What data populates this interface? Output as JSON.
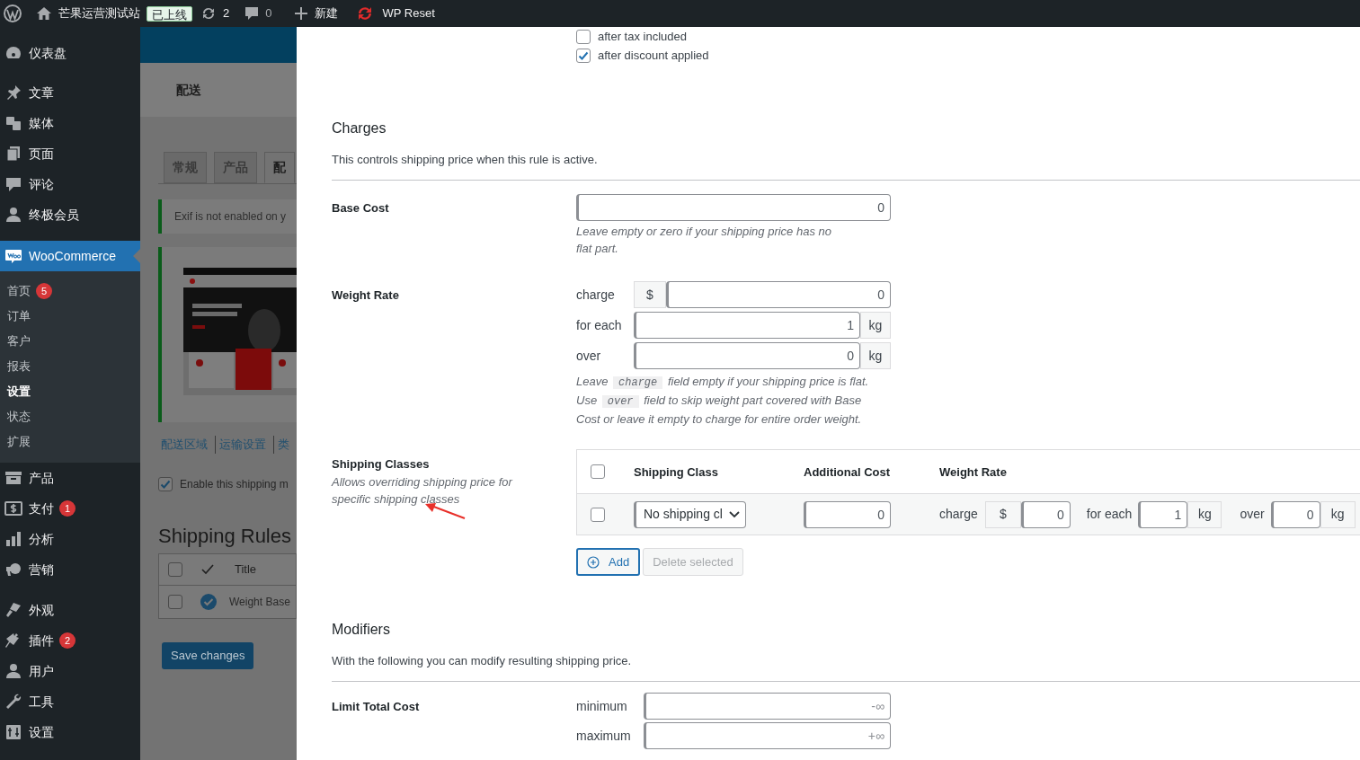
{
  "admin_bar": {
    "site_name": "芒果运营测试站",
    "status_badge": "已上线",
    "updates": "2",
    "comments": "0",
    "new": "新建",
    "plugin": "WP Reset"
  },
  "sidebar": {
    "items": [
      {
        "label": "仪表盘",
        "selected": false
      },
      {
        "label": "文章",
        "selected": false
      },
      {
        "label": "媒体",
        "selected": false
      },
      {
        "label": "页面",
        "selected": false
      },
      {
        "label": "评论",
        "selected": false
      },
      {
        "label": "终极会员",
        "selected": false
      },
      {
        "label": "WooCommerce",
        "selected": true,
        "children": [
          {
            "label": "首页",
            "badge": "5",
            "selected": false
          },
          {
            "label": "订单",
            "selected": false
          },
          {
            "label": "客户",
            "selected": false
          },
          {
            "label": "报表",
            "selected": false
          },
          {
            "label": "设置",
            "selected": true
          },
          {
            "label": "状态",
            "selected": false
          },
          {
            "label": "扩展",
            "selected": false
          }
        ]
      },
      {
        "label": "产品",
        "selected": false
      },
      {
        "label": "支付",
        "badge": "1",
        "selected": false
      },
      {
        "label": "分析",
        "selected": false
      },
      {
        "label": "营销",
        "selected": false
      },
      {
        "label": "外观",
        "selected": false
      },
      {
        "label": "插件",
        "badge": "2",
        "selected": false
      },
      {
        "label": "用户",
        "selected": false
      },
      {
        "label": "工具",
        "selected": false
      },
      {
        "label": "设置",
        "selected": false
      }
    ]
  },
  "background_page": {
    "title": "配送",
    "tabs": [
      {
        "label": "常规",
        "selected": false
      },
      {
        "label": "产品",
        "selected": false
      },
      {
        "label": "配",
        "selected": true
      }
    ],
    "notice": "Exif is not enabled on y",
    "links": [
      "配送区域",
      "运输设置",
      "类"
    ],
    "enable_option": {
      "label": "Enable this shipping m",
      "checked": true
    },
    "heading": "Shipping Rules",
    "rules_table": {
      "header_checked": false,
      "columns": [
        "Title"
      ],
      "rows": [
        {
          "selected": false,
          "enabled": true,
          "title": "Weight Base"
        }
      ]
    },
    "save_button": "Save changes"
  },
  "rule_editor": {
    "apply_options": [
      {
        "label": "after tax included",
        "checked": false
      },
      {
        "label": "after discount applied",
        "checked": true
      }
    ],
    "charges": {
      "title": "Charges",
      "description": "This controls shipping price when this rule is active.",
      "base_cost": {
        "label": "Base Cost",
        "value": "0",
        "help": "Leave empty or zero if your shipping price has no flat part."
      },
      "weight_rate": {
        "label": "Weight Rate",
        "fields": [
          {
            "label": "charge",
            "prefix": "$",
            "value": "0"
          },
          {
            "label": "for each",
            "value": "1",
            "suffix": "kg"
          },
          {
            "label": "over",
            "value": "0",
            "suffix": "kg"
          }
        ],
        "help": [
          {
            "kind": "text",
            "text": "Leave "
          },
          {
            "kind": "code",
            "text": "charge"
          },
          {
            "kind": "text",
            "text": " field empty if your shipping price is flat. Use "
          },
          {
            "kind": "code",
            "text": "over"
          },
          {
            "kind": "text",
            "text": " field to skip weight part covered with Base Cost or leave it empty to charge for entire order weight."
          }
        ]
      },
      "shipping_classes": {
        "label": "Shipping Classes",
        "description": "Allows overriding shipping price for specific shipping classes",
        "header_checked": false,
        "columns": [
          "Shipping Class",
          "Additional Cost",
          "Weight Rate"
        ],
        "rows": [
          {
            "selected": false,
            "shipping_class": "No shipping cl",
            "additional_cost": "0",
            "charge_label": "charge",
            "currency": "$",
            "charge": "0",
            "for_each_label": "for each",
            "for_each": "1",
            "for_each_unit": "kg",
            "over_label": "over",
            "over": "0",
            "over_unit": "kg"
          }
        ],
        "buttons": [
          {
            "kind": "add",
            "label": "Add",
            "disabled": false
          },
          {
            "kind": "delete",
            "label": "Delete selected",
            "disabled": true
          }
        ]
      }
    },
    "modifiers": {
      "title": "Modifiers",
      "description": "With the following you can modify resulting shipping price.",
      "limit_total_cost": {
        "label": "Limit Total Cost",
        "fields": [
          {
            "label": "minimum",
            "placeholder": "-∞"
          },
          {
            "label": "maximum",
            "placeholder": "+∞"
          }
        ]
      }
    }
  }
}
